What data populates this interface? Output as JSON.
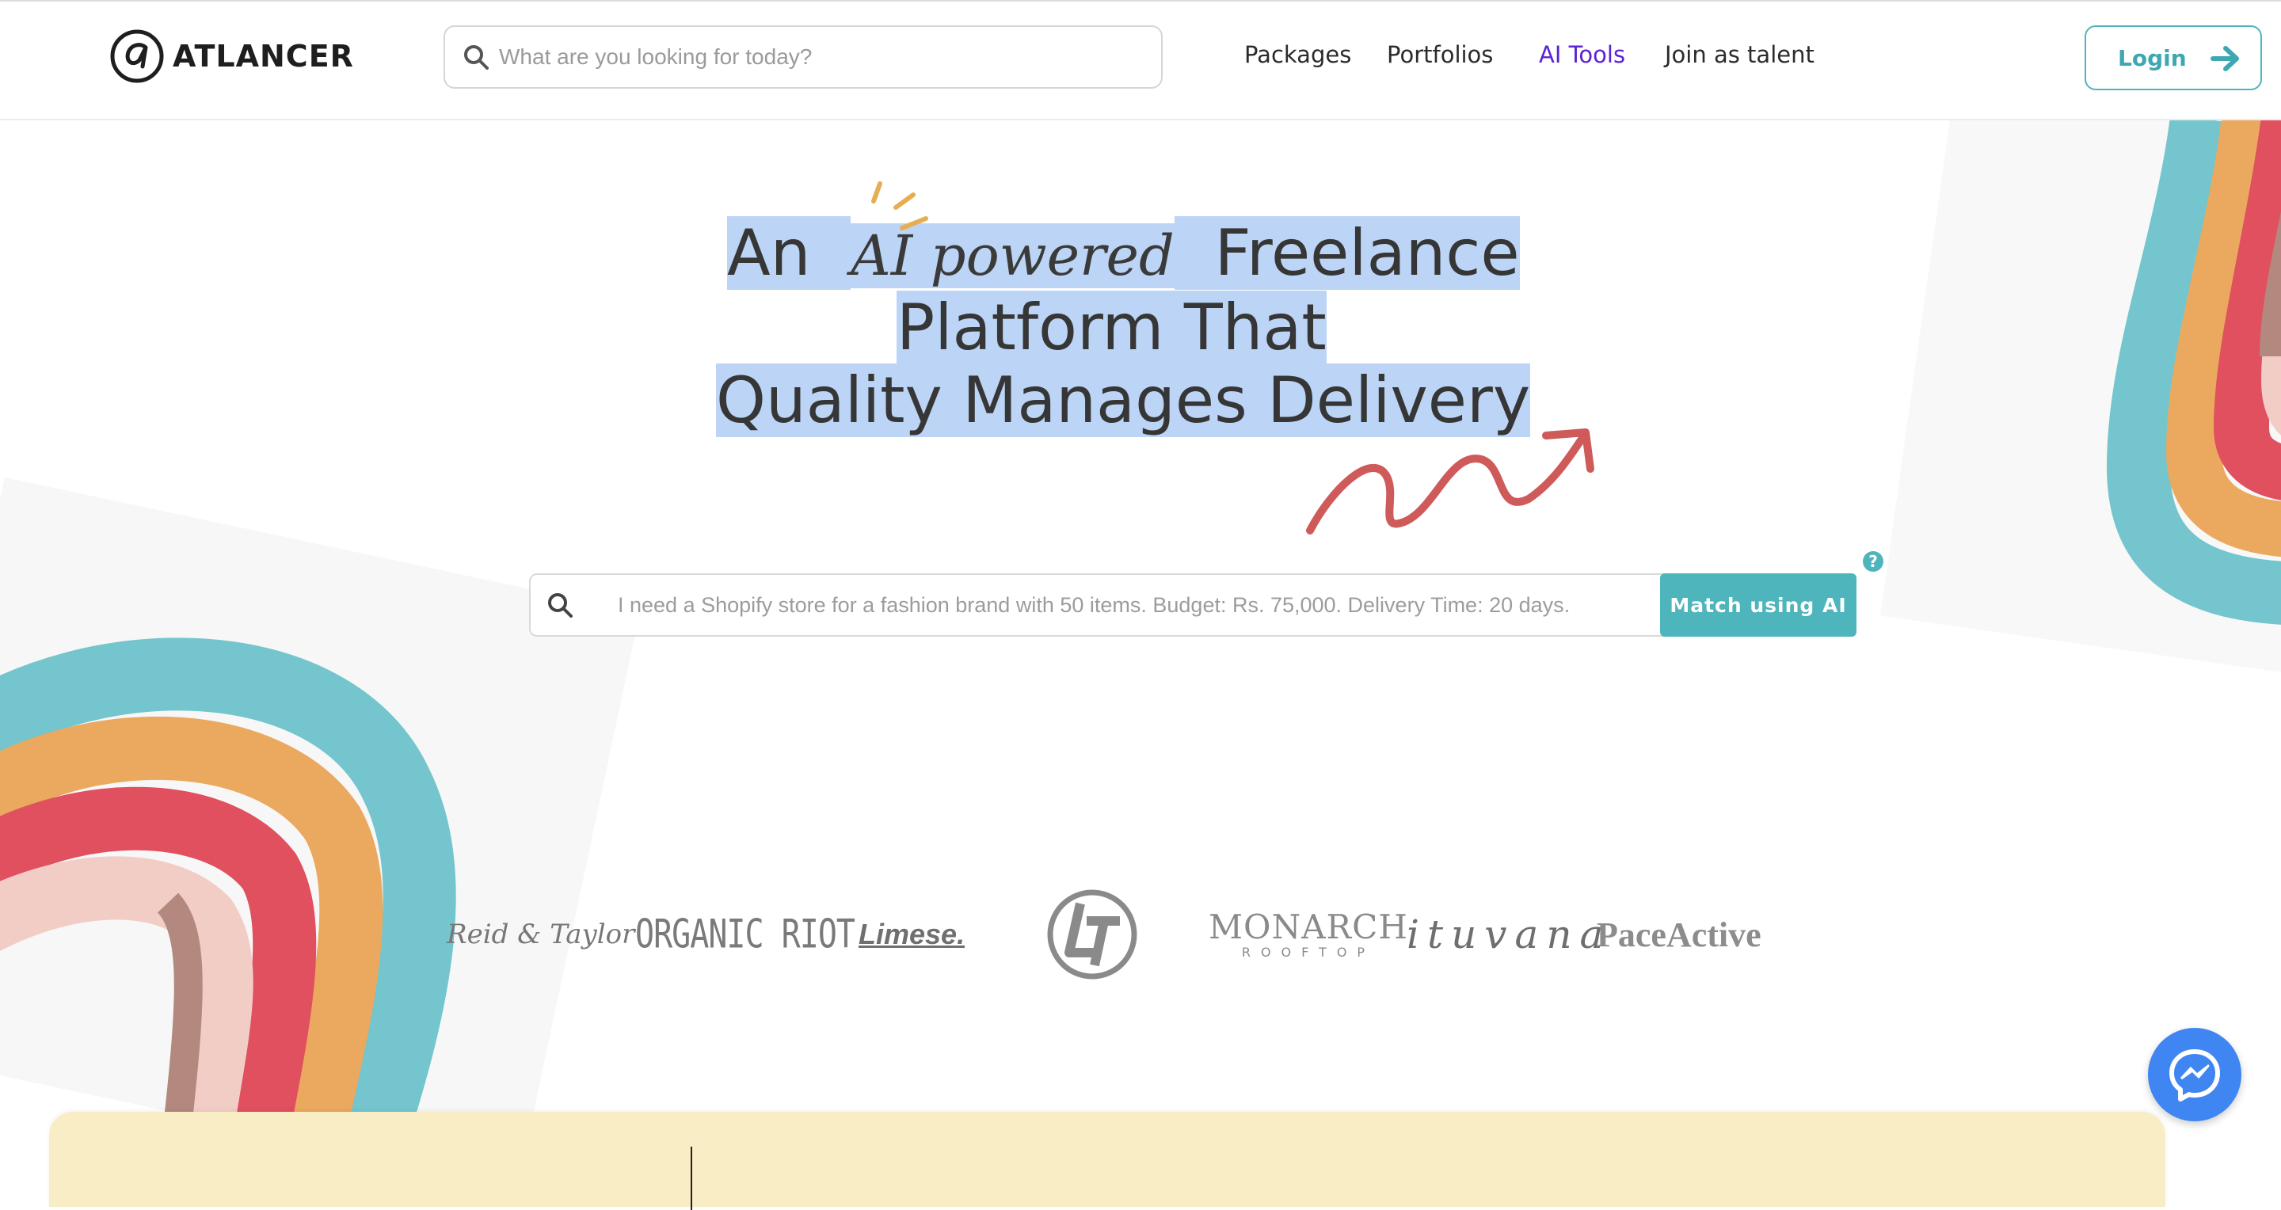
{
  "brand": {
    "name": "ATLANCER"
  },
  "header": {
    "search_placeholder": "What are you looking for today?",
    "nav": [
      "Packages",
      "Portfolios",
      "AI Tools",
      "Join as talent"
    ],
    "active_nav": "AI Tools",
    "login_label": "Login"
  },
  "hero": {
    "line1_prefix": "An",
    "line1_ai": "AI",
    "line1_powered": "powered",
    "line1_suffix": "Freelance",
    "line2": "Platform That",
    "line3": "Quality Manages Delivery"
  },
  "match": {
    "placeholder": "I need a Shopify store for a fashion brand with 50 items. Budget: Rs. 75,000. Delivery Time: 20 days.",
    "button_label": "Match using AI",
    "help_label": "?"
  },
  "clients": {
    "reid": "Reid & Taylor",
    "organic": "ORGANIC RIOT",
    "limese": "Limese.",
    "lt": "L&T",
    "monarch": "MONARCH",
    "monarch_sub": "ROOFTOP",
    "ituvana": "ituvana",
    "pace": "PaceActive"
  },
  "colors": {
    "accent_teal": "#4fb5bd",
    "accent_purple": "#5b21d6",
    "selection": "#bcd4f5",
    "messenger": "#3f86f2"
  }
}
